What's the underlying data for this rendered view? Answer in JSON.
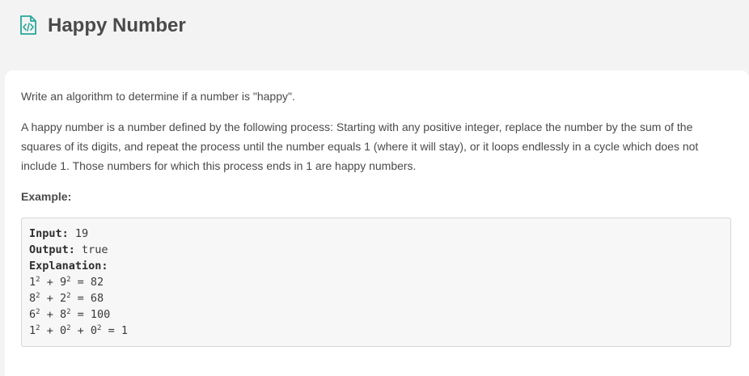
{
  "header": {
    "title": "Happy Number",
    "icon": "code-file-icon",
    "icon_color": "#26a69a"
  },
  "description": {
    "intro": "Write an algorithm to determine if a number is \"happy\".",
    "body": "A happy number is a number defined by the following process: Starting with any positive integer, replace the number by the sum of the squares of its digits, and repeat the process until the number equals 1 (where it will stay), or it loops endlessly in a cycle which does not include 1. Those numbers for which this process ends in 1 are happy numbers."
  },
  "example": {
    "label": "Example:",
    "input_label": "Input:",
    "input_value": "19",
    "output_label": "Output:",
    "output_value": "true",
    "explanation_label": "Explanation:",
    "steps": [
      {
        "a": "1",
        "b": "9",
        "c": null,
        "result": "82"
      },
      {
        "a": "8",
        "b": "2",
        "c": null,
        "result": "68"
      },
      {
        "a": "6",
        "b": "8",
        "c": null,
        "result": "100"
      },
      {
        "a": "1",
        "b": "0",
        "c": "0",
        "result": "1"
      }
    ],
    "exponent": "2"
  }
}
